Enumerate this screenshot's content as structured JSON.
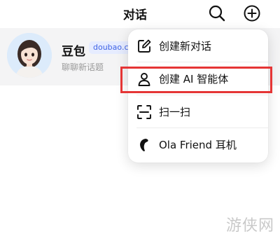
{
  "header": {
    "title": "对话",
    "search_icon": "search-icon",
    "add_icon": "plus-circle-icon"
  },
  "chat": {
    "name": "豆包",
    "tag": "doubao.c",
    "subtitle": "聊聊新话题",
    "avatar_icon": "avatar-icon"
  },
  "menu": {
    "items": [
      {
        "label": "创建新对话",
        "icon": "edit-icon"
      },
      {
        "label": "创建 AI 智能体",
        "icon": "person-icon"
      },
      {
        "label": "扫一扫",
        "icon": "scan-icon"
      },
      {
        "label": "Ola Friend 耳机",
        "icon": "earphone-icon"
      }
    ]
  },
  "highlight_color": "#e53535",
  "watermark": "游侠网"
}
